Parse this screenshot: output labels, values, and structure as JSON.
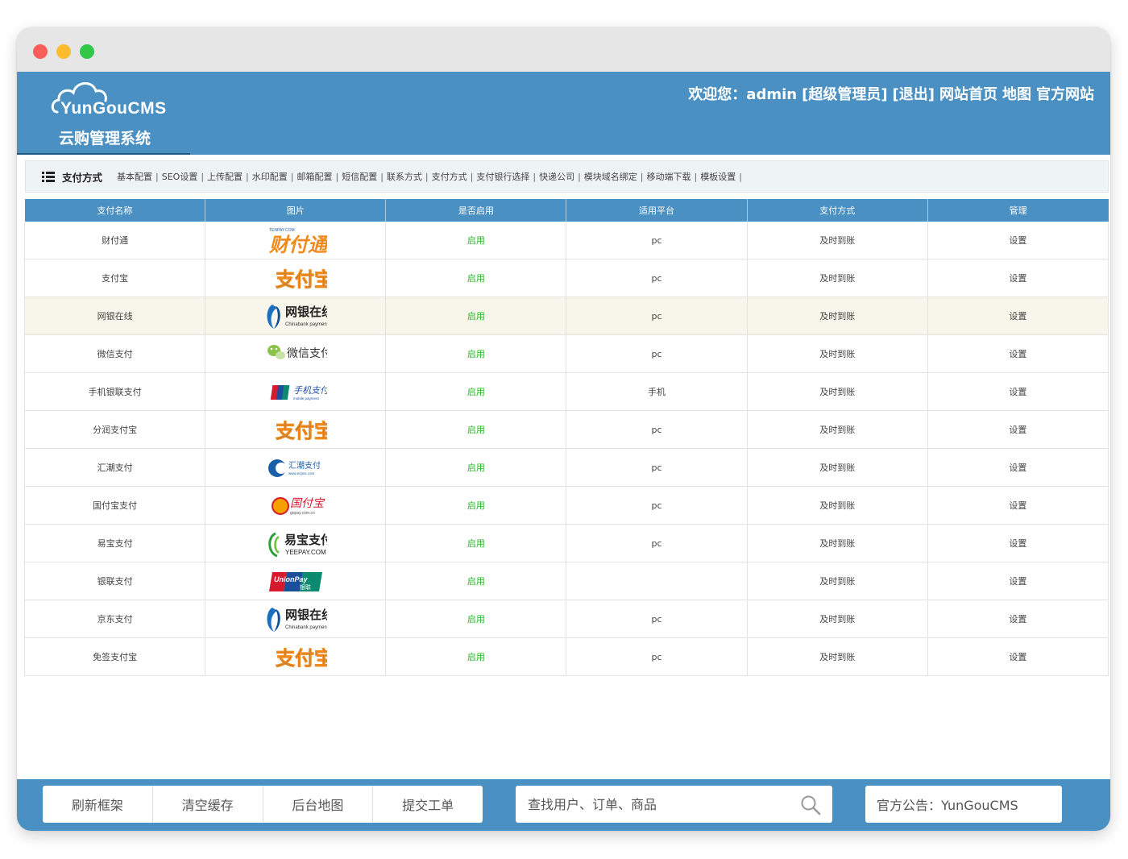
{
  "header": {
    "logo_en": "YunGouCMS",
    "logo_cn": "云购管理系统",
    "welcome": "欢迎您：admin",
    "role": "[超级管理员]",
    "logout": "[退出]",
    "home": "网站首页",
    "map": "地图",
    "official": "官方网站"
  },
  "subnav": {
    "title": "支付方式",
    "links": [
      "基本配置",
      "SEO设置",
      "上传配置",
      "水印配置",
      "邮箱配置",
      "短信配置",
      "联系方式",
      "支付方式",
      "支付银行选择",
      "快递公司",
      "模块域名绑定",
      "移动端下载",
      "模板设置"
    ]
  },
  "table": {
    "headers": [
      "支付名称",
      "图片",
      "是否启用",
      "适用平台",
      "支付方式",
      "管理"
    ],
    "rows": [
      {
        "name": "财付通",
        "logo": "tenpay-logo",
        "enabled": "启用",
        "platform": "pc",
        "method": "及时到账",
        "manage": "设置"
      },
      {
        "name": "支付宝",
        "logo": "alipay-logo",
        "enabled": "启用",
        "platform": "pc",
        "method": "及时到账",
        "manage": "设置"
      },
      {
        "name": "网银在线",
        "logo": "chinabank-logo",
        "enabled": "启用",
        "platform": "pc",
        "method": "及时到账",
        "manage": "设置"
      },
      {
        "name": "微信支付",
        "logo": "wechat-pay-logo",
        "enabled": "启用",
        "platform": "pc",
        "method": "及时到账",
        "manage": "设置"
      },
      {
        "name": "手机银联支付",
        "logo": "unionpay-mobile-logo",
        "enabled": "启用",
        "platform": "手机",
        "method": "及时到账",
        "manage": "设置"
      },
      {
        "name": "分润支付宝",
        "logo": "alipay-logo",
        "enabled": "启用",
        "platform": "pc",
        "method": "及时到账",
        "manage": "设置"
      },
      {
        "name": "汇潮支付",
        "logo": "ecpss-logo",
        "enabled": "启用",
        "platform": "pc",
        "method": "及时到账",
        "manage": "设置"
      },
      {
        "name": "国付宝支付",
        "logo": "gopay-logo",
        "enabled": "启用",
        "platform": "pc",
        "method": "及时到账",
        "manage": "设置"
      },
      {
        "name": "易宝支付",
        "logo": "yeepay-logo",
        "enabled": "启用",
        "platform": "pc",
        "method": "及时到账",
        "manage": "设置"
      },
      {
        "name": "银联支付",
        "logo": "unionpay-logo",
        "enabled": "启用",
        "platform": "",
        "method": "及时到账",
        "manage": "设置"
      },
      {
        "name": "京东支付",
        "logo": "chinabank-logo",
        "enabled": "启用",
        "platform": "pc",
        "method": "及时到账",
        "manage": "设置"
      },
      {
        "name": "免签支付宝",
        "logo": "alipay-logo",
        "enabled": "启用",
        "platform": "pc",
        "method": "及时到账",
        "manage": "设置"
      }
    ]
  },
  "logo_text": {
    "tenpay": "财付通",
    "tenpay_small": "TENPAY.COM",
    "alipay": "支付宝",
    "chinabank": "网银在线",
    "chinabank_en": "Chinabank payments",
    "wechat": "微信支付",
    "unionpay_mobile": "手机支付",
    "unionpay_mobile_en": "mobile payment",
    "ecpss": "汇潮支付",
    "ecpss_en": "www.ecpss.com",
    "gopay": "国付宝",
    "gopay_en": "gopay.com.cn",
    "yeepay": "易宝支付",
    "yeepay_en": "YEEPAY.COM",
    "unionpay": "UnionPay",
    "unionpay_cn": "银联"
  },
  "footer": {
    "buttons": [
      "刷新框架",
      "清空缓存",
      "后台地图",
      "提交工单"
    ],
    "search_placeholder": "查找用户、订单、商品",
    "notice": "官方公告：YunGouCMS"
  },
  "colors": {
    "header_bg": "#4a90c2",
    "enabled_text": "#22b722",
    "highlight_row": "#f8f6ea"
  }
}
